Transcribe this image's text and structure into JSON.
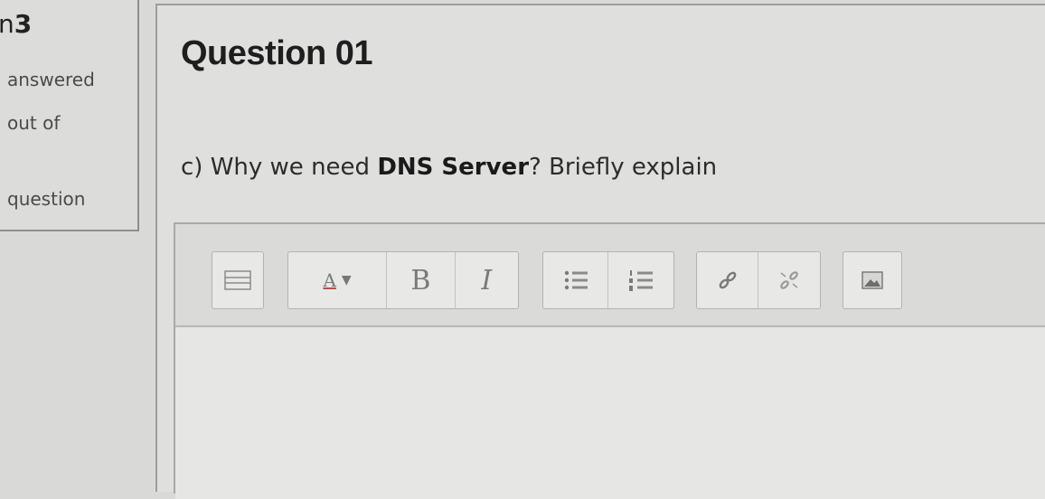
{
  "sidebar": {
    "question_label_prefix": "n",
    "question_number": "3",
    "status": "answered",
    "marks": "out of",
    "flag": "question"
  },
  "question": {
    "title": "Question 01",
    "prefix": "c) Why we need ",
    "bold": "DNS Server",
    "suffix": "? Briefly explain"
  },
  "toolbar": {
    "font_label": "A",
    "bold_label": "B",
    "italic_label": "I",
    "icons": [
      "toolbar-toggle-icon",
      "font-color-icon",
      "bold-icon",
      "italic-icon",
      "unordered-list-icon",
      "ordered-list-icon",
      "link-icon",
      "unlink-icon",
      "image-icon"
    ]
  },
  "editor": {
    "content": ""
  }
}
